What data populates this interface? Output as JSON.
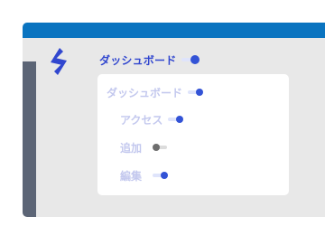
{
  "header": {
    "title": "ダッシュボード",
    "title_toggle_on": true
  },
  "menu": {
    "items": [
      {
        "label": "ダッシュボード",
        "enabled": true
      },
      {
        "label": "アクセス",
        "enabled": true
      },
      {
        "label": "追加",
        "enabled": false
      },
      {
        "label": "編集",
        "enabled": true
      }
    ]
  },
  "icons": {
    "logo": "brand-logo-icon"
  },
  "colors": {
    "topbar": "#0a74c0",
    "accent": "#3353d6",
    "sidebar": "#5c6576",
    "menu_text": "#c3c8ee"
  }
}
